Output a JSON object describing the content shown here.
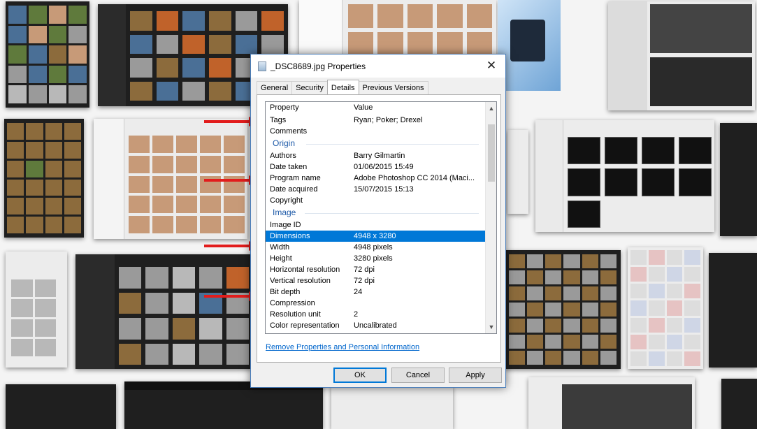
{
  "dialog": {
    "title": "_DSC8689.jpg Properties",
    "close_symbol": "✕",
    "tabs": [
      {
        "label": "General",
        "active": false
      },
      {
        "label": "Security",
        "active": false
      },
      {
        "label": "Details",
        "active": true
      },
      {
        "label": "Previous Versions",
        "active": false
      }
    ],
    "columns": {
      "property": "Property",
      "value": "Value"
    },
    "rows": [
      {
        "property": "Tags",
        "value": "Ryan; Poker; Drexel"
      },
      {
        "property": "Comments",
        "value": ""
      }
    ],
    "origin_group": "Origin",
    "origin_rows": [
      {
        "property": "Authors",
        "value": "Barry Gilmartin"
      },
      {
        "property": "Date taken",
        "value": "01/06/2015 15:49"
      },
      {
        "property": "Program name",
        "value": "Adobe Photoshop CC 2014 (Maci..."
      },
      {
        "property": "Date acquired",
        "value": "15/07/2015 15:13"
      },
      {
        "property": "Copyright",
        "value": ""
      }
    ],
    "image_group": "Image",
    "image_rows": [
      {
        "property": "Image ID",
        "value": ""
      },
      {
        "property": "Dimensions",
        "value": "4948 x 3280",
        "selected": true
      },
      {
        "property": "Width",
        "value": "4948 pixels"
      },
      {
        "property": "Height",
        "value": "3280 pixels"
      },
      {
        "property": "Horizontal resolution",
        "value": "72 dpi"
      },
      {
        "property": "Vertical resolution",
        "value": "72 dpi"
      },
      {
        "property": "Bit depth",
        "value": "24"
      },
      {
        "property": "Compression",
        "value": ""
      },
      {
        "property": "Resolution unit",
        "value": "2"
      },
      {
        "property": "Color representation",
        "value": "Uncalibrated"
      }
    ],
    "remove_link": "Remove Properties and Personal Information",
    "buttons": {
      "ok": "OK",
      "cancel": "Cancel",
      "apply": "Apply"
    },
    "scroll_up_icon": "▲",
    "scroll_down_icon": "▼"
  },
  "colors": {
    "selection": "#0078d7",
    "arrow": "#e21c1c",
    "group_header": "#1e5aa8",
    "link": "#0066cc"
  },
  "icons": [
    "file-icon",
    "close-icon",
    "scroll-up-icon",
    "scroll-down-icon",
    "red-arrow"
  ]
}
